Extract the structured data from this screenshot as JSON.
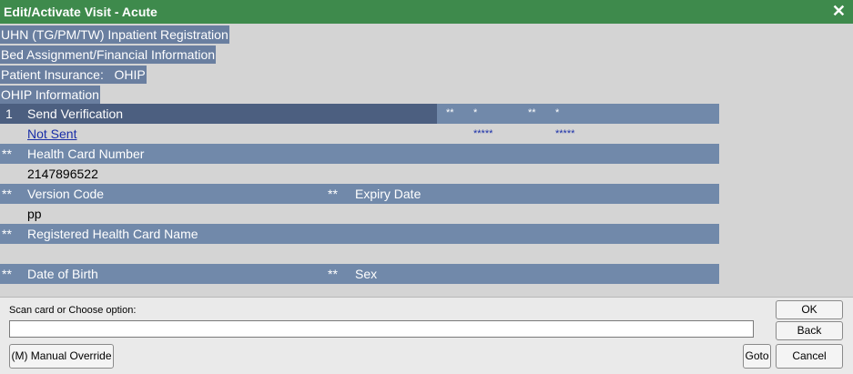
{
  "window": {
    "title": "Edit/Activate Visit - Acute",
    "close_glyph": "✕"
  },
  "breadcrumbs": [
    "UHN (TG/PM/TW) Inpatient Registration",
    "Bed Assignment/Financial Information",
    "Patient Insurance:   OHIP",
    "OHIP Information"
  ],
  "form": {
    "send_verification": {
      "number": "1",
      "label": "Send Verification",
      "col_a_req": "**",
      "col_a_mark": "*",
      "col_b_req": "**",
      "col_b_mark": "*"
    },
    "send_status": {
      "value": "Not Sent",
      "stars_a": "*****",
      "stars_b": "*****"
    },
    "health_card": {
      "req": "**",
      "label": "Health Card Number",
      "value": "2147896522"
    },
    "version": {
      "req": "**",
      "label": "Version Code",
      "value": "pp",
      "expiry_req": "**",
      "expiry_label": "Expiry Date",
      "expiry_value": ""
    },
    "registered_name": {
      "req": "**",
      "label": "Registered Health Card Name",
      "value": ""
    },
    "dob": {
      "req": "**",
      "label": "Date of Birth",
      "sex_req": "**",
      "sex_label": "Sex"
    }
  },
  "bottom": {
    "prompt": "Scan card or Choose option:",
    "input_value": "",
    "ok": "OK",
    "back": "Back",
    "manual_override": "(M) Manual Override",
    "goto": "Goto",
    "cancel": "Cancel"
  },
  "colors": {
    "title_bar": "#3e8a4c",
    "header_row": "#7189aa",
    "header_dark": "#4c5f80",
    "link": "#1a2fa8",
    "background": "#d4d4d4"
  }
}
